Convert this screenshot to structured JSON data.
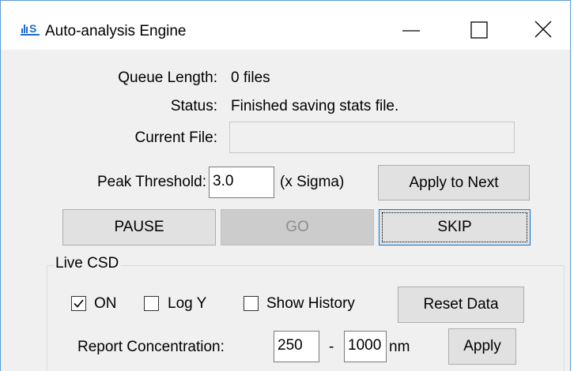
{
  "window": {
    "title": "Auto-analysis Engine",
    "icon": "app-logo-icon",
    "controls": [
      "minimize-icon",
      "maximize-icon",
      "close-icon"
    ]
  },
  "queue": {
    "label": "Queue Length:",
    "value": "0 files"
  },
  "status": {
    "label": "Status:",
    "value": "Finished saving stats file."
  },
  "current_file": {
    "label": "Current File:",
    "value": ""
  },
  "threshold": {
    "label": "Peak Threshold:",
    "value": "3.0",
    "unit": "(x Sigma)",
    "apply_label": "Apply to Next"
  },
  "controls": {
    "pause_label": "PAUSE",
    "go_label": "GO",
    "skip_label": "SKIP"
  },
  "live_csd": {
    "group_label": "Live CSD",
    "on_label": "ON",
    "on_checked": true,
    "log_y_label": "Log Y",
    "log_y_checked": false,
    "show_history_label": "Show History",
    "show_history_checked": false,
    "reset_label": "Reset Data"
  },
  "report": {
    "label": "Report Concentration:",
    "min_value": "250",
    "separator": "-",
    "max_value": "1000",
    "unit": "nm",
    "apply_label": "Apply"
  },
  "colors": {
    "window_border": "#5b9bd5",
    "client_bg": "#f0f0f0",
    "button_bg": "#e1e1e1",
    "button_disabled_bg": "#cccccc",
    "focus_border": "#0078d7",
    "icon_blue": "#1e6ec8"
  }
}
